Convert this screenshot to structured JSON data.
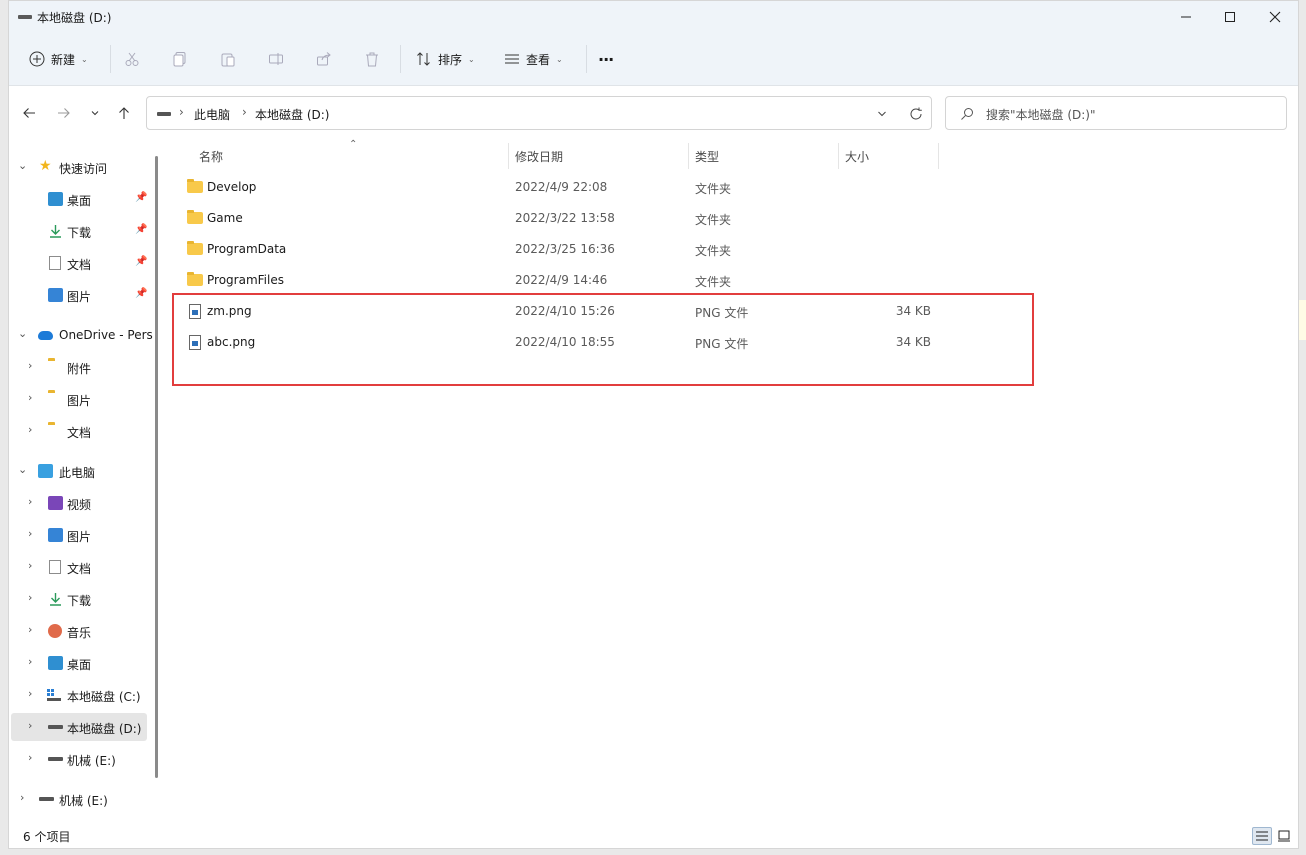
{
  "window": {
    "title": "本地磁盘 (D:)"
  },
  "colors": {
    "highlight_box": "#e23d3d",
    "folder": "#f8c94a",
    "accent": "#2f8fd1"
  },
  "toolbar": {
    "new_label": "新建",
    "sort_label": "排序",
    "view_label": "查看",
    "more_label": "···",
    "icons": [
      "cut-icon",
      "copy-icon",
      "paste-icon",
      "rename-icon",
      "share-icon",
      "delete-icon"
    ]
  },
  "address": {
    "crumbs": [
      "此电脑",
      "本地磁盘 (D:)"
    ],
    "search_placeholder": "搜索\"本地磁盘 (D:)\""
  },
  "sidebar": {
    "quick_access": {
      "label": "快速访问",
      "items": [
        {
          "label": "桌面",
          "icon": "desktop-icon"
        },
        {
          "label": "下载",
          "icon": "download-icon"
        },
        {
          "label": "文档",
          "icon": "document-icon"
        },
        {
          "label": "图片",
          "icon": "pictures-icon"
        }
      ]
    },
    "onedrive": {
      "label": "OneDrive - Pers",
      "items": [
        {
          "label": "附件",
          "icon": "folder-icon"
        },
        {
          "label": "图片",
          "icon": "folder-icon"
        },
        {
          "label": "文档",
          "icon": "folder-icon"
        }
      ]
    },
    "this_pc": {
      "label": "此电脑",
      "items": [
        {
          "label": "视频",
          "icon": "video-icon"
        },
        {
          "label": "图片",
          "icon": "pictures-icon"
        },
        {
          "label": "文档",
          "icon": "document-icon"
        },
        {
          "label": "下载",
          "icon": "download-icon"
        },
        {
          "label": "音乐",
          "icon": "music-icon"
        },
        {
          "label": "桌面",
          "icon": "desktop-icon"
        },
        {
          "label": "本地磁盘 (C:)",
          "icon": "windows-drive-icon"
        },
        {
          "label": "本地磁盘 (D:)",
          "icon": "drive-icon",
          "selected": true
        },
        {
          "label": "机械 (E:)",
          "icon": "drive-icon"
        }
      ]
    },
    "extra_drive": {
      "label": "机械 (E:)",
      "icon": "drive-icon"
    }
  },
  "columns": {
    "name": "名称",
    "modified": "修改日期",
    "type": "类型",
    "size": "大小"
  },
  "files": [
    {
      "name": "Develop",
      "modified": "2022/4/9 22:08",
      "type": "文件夹",
      "size": "",
      "kind": "folder"
    },
    {
      "name": "Game",
      "modified": "2022/3/22 13:58",
      "type": "文件夹",
      "size": "",
      "kind": "folder"
    },
    {
      "name": "ProgramData",
      "modified": "2022/3/25 16:36",
      "type": "文件夹",
      "size": "",
      "kind": "folder"
    },
    {
      "name": "ProgramFiles",
      "modified": "2022/4/9 14:46",
      "type": "文件夹",
      "size": "",
      "kind": "folder"
    },
    {
      "name": "zm.png",
      "modified": "2022/4/10 15:26",
      "type": "PNG 文件",
      "size": "34 KB",
      "kind": "image"
    },
    {
      "name": "abc.png",
      "modified": "2022/4/10 18:55",
      "type": "PNG 文件",
      "size": "34 KB",
      "kind": "image"
    }
  ],
  "status": {
    "item_count": "6 个项目"
  }
}
